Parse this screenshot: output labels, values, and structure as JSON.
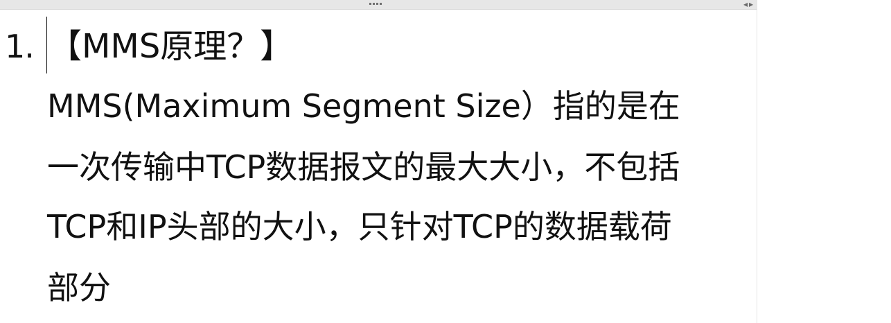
{
  "list": {
    "number": "1.",
    "heading": "【MMS原理？】",
    "body_lines": [
      "MMS(Maximum Segment Size）指的是在",
      "一次传输中TCP数据报文的最大大小，不包括",
      "TCP和IP头部的大小，只针对TCP的数据载荷",
      "部分"
    ]
  },
  "toolbar": {
    "grip_icon": "horizontal-dots",
    "scroll_left_icon": "triangle-left",
    "scroll_right_icon": "triangle-right"
  },
  "colors": {
    "top_bar": "#e7e7e7",
    "text": "#111111",
    "background": "#ffffff"
  }
}
